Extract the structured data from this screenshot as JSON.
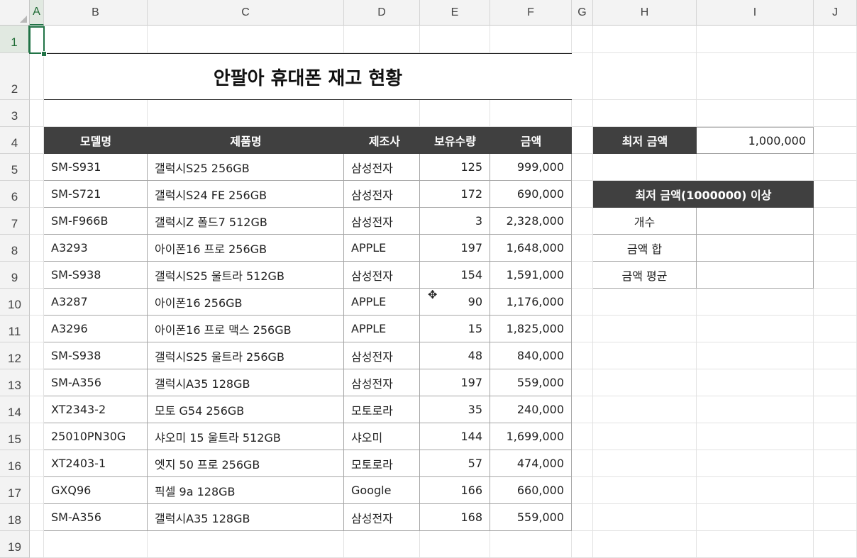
{
  "columns": [
    "A",
    "B",
    "C",
    "D",
    "E",
    "F",
    "G",
    "H",
    "I",
    "J"
  ],
  "rows": [
    "1",
    "2",
    "3",
    "4",
    "5",
    "6",
    "7",
    "8",
    "9",
    "10",
    "11",
    "12",
    "13",
    "14",
    "15",
    "16",
    "17",
    "18",
    "19"
  ],
  "title": "안팔아 휴대폰 재고 현황",
  "table": {
    "headers": [
      "모델명",
      "제품명",
      "제조사",
      "보유수량",
      "금액"
    ],
    "rows": [
      [
        "SM-S931",
        "갤럭시S25 256GB",
        "삼성전자",
        "125",
        "999,000"
      ],
      [
        "SM-S721",
        "갤럭시S24 FE 256GB",
        "삼성전자",
        "172",
        "690,000"
      ],
      [
        "SM-F966B",
        "갤럭시Z 폴드7 512GB",
        "삼성전자",
        "3",
        "2,328,000"
      ],
      [
        "A3293",
        "아이폰16 프로 256GB",
        "APPLE",
        "197",
        "1,648,000"
      ],
      [
        "SM-S938",
        "갤럭시S25 울트라 512GB",
        "삼성전자",
        "154",
        "1,591,000"
      ],
      [
        "A3287",
        "아이폰16 256GB",
        "APPLE",
        "90",
        "1,176,000"
      ],
      [
        "A3296",
        "아이폰16 프로 맥스 256GB",
        "APPLE",
        "15",
        "1,825,000"
      ],
      [
        "SM-S938",
        "갤럭시S25 울트라 256GB",
        "삼성전자",
        "48",
        "840,000"
      ],
      [
        "SM-A356",
        "갤럭시A35 128GB",
        "삼성전자",
        "197",
        "559,000"
      ],
      [
        "XT2343-2",
        "모토 G54 256GB",
        "모토로라",
        "35",
        "240,000"
      ],
      [
        "25010PN30G",
        "샤오미 15 울트라 512GB",
        "샤오미",
        "144",
        "1,699,000"
      ],
      [
        "XT2403-1",
        "엣지 50 프로 256GB",
        "모토로라",
        "57",
        "474,000"
      ],
      [
        "GXQ96",
        "픽셀 9a 128GB",
        "Google",
        "166",
        "660,000"
      ],
      [
        "SM-A356",
        "갤럭시A35 128GB",
        "삼성전자",
        "168",
        "559,000"
      ]
    ]
  },
  "side": {
    "min_label": "최저 금액",
    "min_value": "1,000,000",
    "section_header": "최저 금액(1000000) 이상",
    "items": [
      {
        "label": "개수",
        "value": ""
      },
      {
        "label": "금액 합",
        "value": ""
      },
      {
        "label": "금액 평균",
        "value": ""
      }
    ]
  },
  "colors": {
    "header_bg": "#404040",
    "selection": "#217346"
  }
}
